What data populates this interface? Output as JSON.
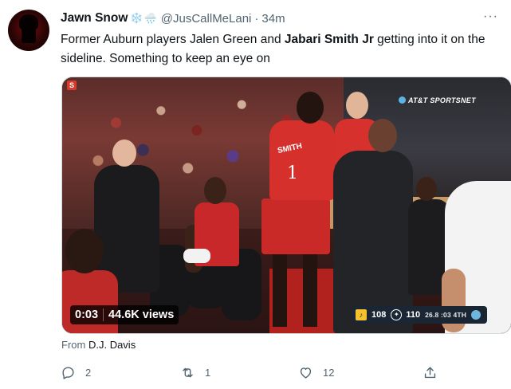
{
  "tweet": {
    "author_name": "Jawn Snow",
    "author_emoji": "❄️",
    "author_emoji2": "🌧️",
    "handle": "@JusCallMeLani",
    "separator": "·",
    "time": "34m",
    "more_label": "···",
    "text_part1": "Former Auburn players Jalen Green and ",
    "text_bold": "Jabari Smith Jr",
    "text_part2": " getting into it on the sideline. Something to keep an eye on"
  },
  "video": {
    "duration": "0:03",
    "views": "44.6K views",
    "network_logo": "AT&T SPORTSNET",
    "corner_logo": "S",
    "jersey_name": "SMITH",
    "jersey_number": "1",
    "scoreboard": {
      "team_a_score": "108",
      "team_b_score": "110",
      "clock": "26.8 :03 4TH"
    }
  },
  "attribution": {
    "prefix": "From",
    "source": "D.J. Davis"
  },
  "actions": {
    "reply_count": "2",
    "retweet_count": "1",
    "like_count": "12"
  },
  "colors": {
    "text_primary": "#0f1419",
    "text_secondary": "#536471",
    "rockets_red": "#ce1141"
  }
}
